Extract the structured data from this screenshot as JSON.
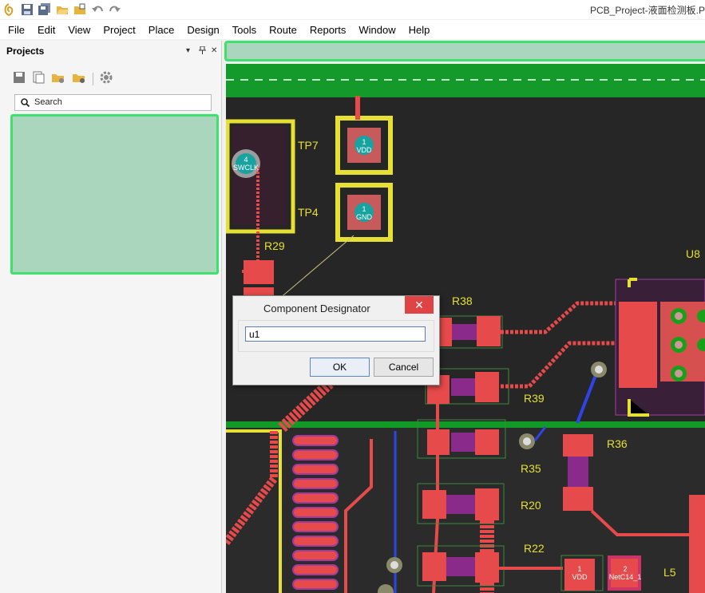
{
  "window": {
    "title": "PCB_Project-液面检测板.P"
  },
  "quick_access": [
    "app-logo-icon",
    "save-icon",
    "save-all-icon",
    "open-icon",
    "open-project-icon",
    "undo-icon",
    "redo-icon"
  ],
  "menu": [
    {
      "label": "File",
      "name": "menu-file"
    },
    {
      "label": "Edit",
      "name": "menu-edit"
    },
    {
      "label": "View",
      "name": "menu-view"
    },
    {
      "label": "Project",
      "name": "menu-project"
    },
    {
      "label": "Place",
      "name": "menu-place"
    },
    {
      "label": "Design",
      "name": "menu-design"
    },
    {
      "label": "Tools",
      "name": "menu-tools"
    },
    {
      "label": "Route",
      "name": "menu-route"
    },
    {
      "label": "Reports",
      "name": "menu-reports"
    },
    {
      "label": "Window",
      "name": "menu-window"
    },
    {
      "label": "Help",
      "name": "menu-help"
    }
  ],
  "projects_panel": {
    "title": "Projects",
    "controls": {
      "dropdown": "▾",
      "pin": "ᵖ",
      "close": "✕"
    },
    "search": {
      "placeholder": "Search"
    }
  },
  "pcb": {
    "labels": [
      "TP7",
      "TP4",
      "R29",
      "R38",
      "U8",
      "R39",
      "R35",
      "R36",
      "R20",
      "R22",
      "L5"
    ],
    "pads": [
      {
        "num": "4",
        "net": "SWCLK"
      },
      {
        "num": "1",
        "net": "VDD"
      },
      {
        "num": "1",
        "net": "GND"
      },
      {
        "num": "1",
        "net": "VDD"
      },
      {
        "num": "2",
        "net": "NetC14_1"
      }
    ]
  },
  "dialog": {
    "title": "Component Designator",
    "close": "✕",
    "input_value": "u1",
    "ok_label": "OK",
    "cancel_label": "Cancel"
  },
  "colors": {
    "highlight_green": "#3ee26a",
    "highlight_fill": "#a9d6bd",
    "pcb_bg": "#2a2a2a",
    "track_red": "#ee4444",
    "silk_yellow": "#e5e033"
  }
}
